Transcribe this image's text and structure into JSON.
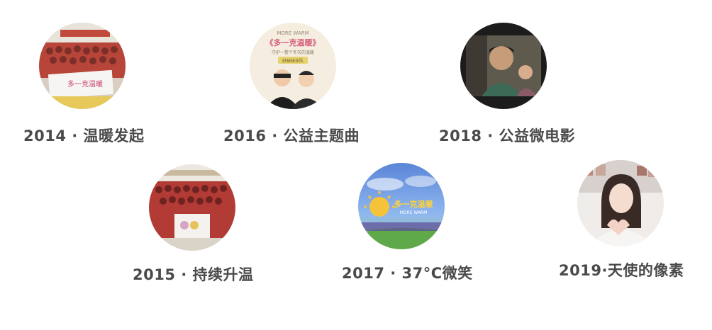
{
  "milestones": [
    {
      "caption": "2014 · 温暖发起",
      "image_subject": "group of volunteers holding a banner",
      "banner_text": "多一克温暖"
    },
    {
      "caption": "2016 · 公益主题曲",
      "image_subject": "theme song poster with two singers",
      "poster_header": "MORE WARM",
      "poster_title": "《多一克温暖》",
      "poster_subtitle": "守护一整个冬天的温暖",
      "poster_tag": "好妹妹乐队"
    },
    {
      "caption": "2018 · 公益微电影",
      "image_subject": "still from a short film with children"
    },
    {
      "caption": "2015 · 持续升温",
      "image_subject": "group photo of students in red uniforms"
    },
    {
      "caption": "2017 · 37°C微笑",
      "image_subject": "colorful campaign poster with sun logo",
      "poster_title": "多一克温暖",
      "poster_header": "MORE WARM"
    },
    {
      "caption": "2019·天使的像素",
      "image_subject": "smiling woman making a heart gesture"
    }
  ]
}
